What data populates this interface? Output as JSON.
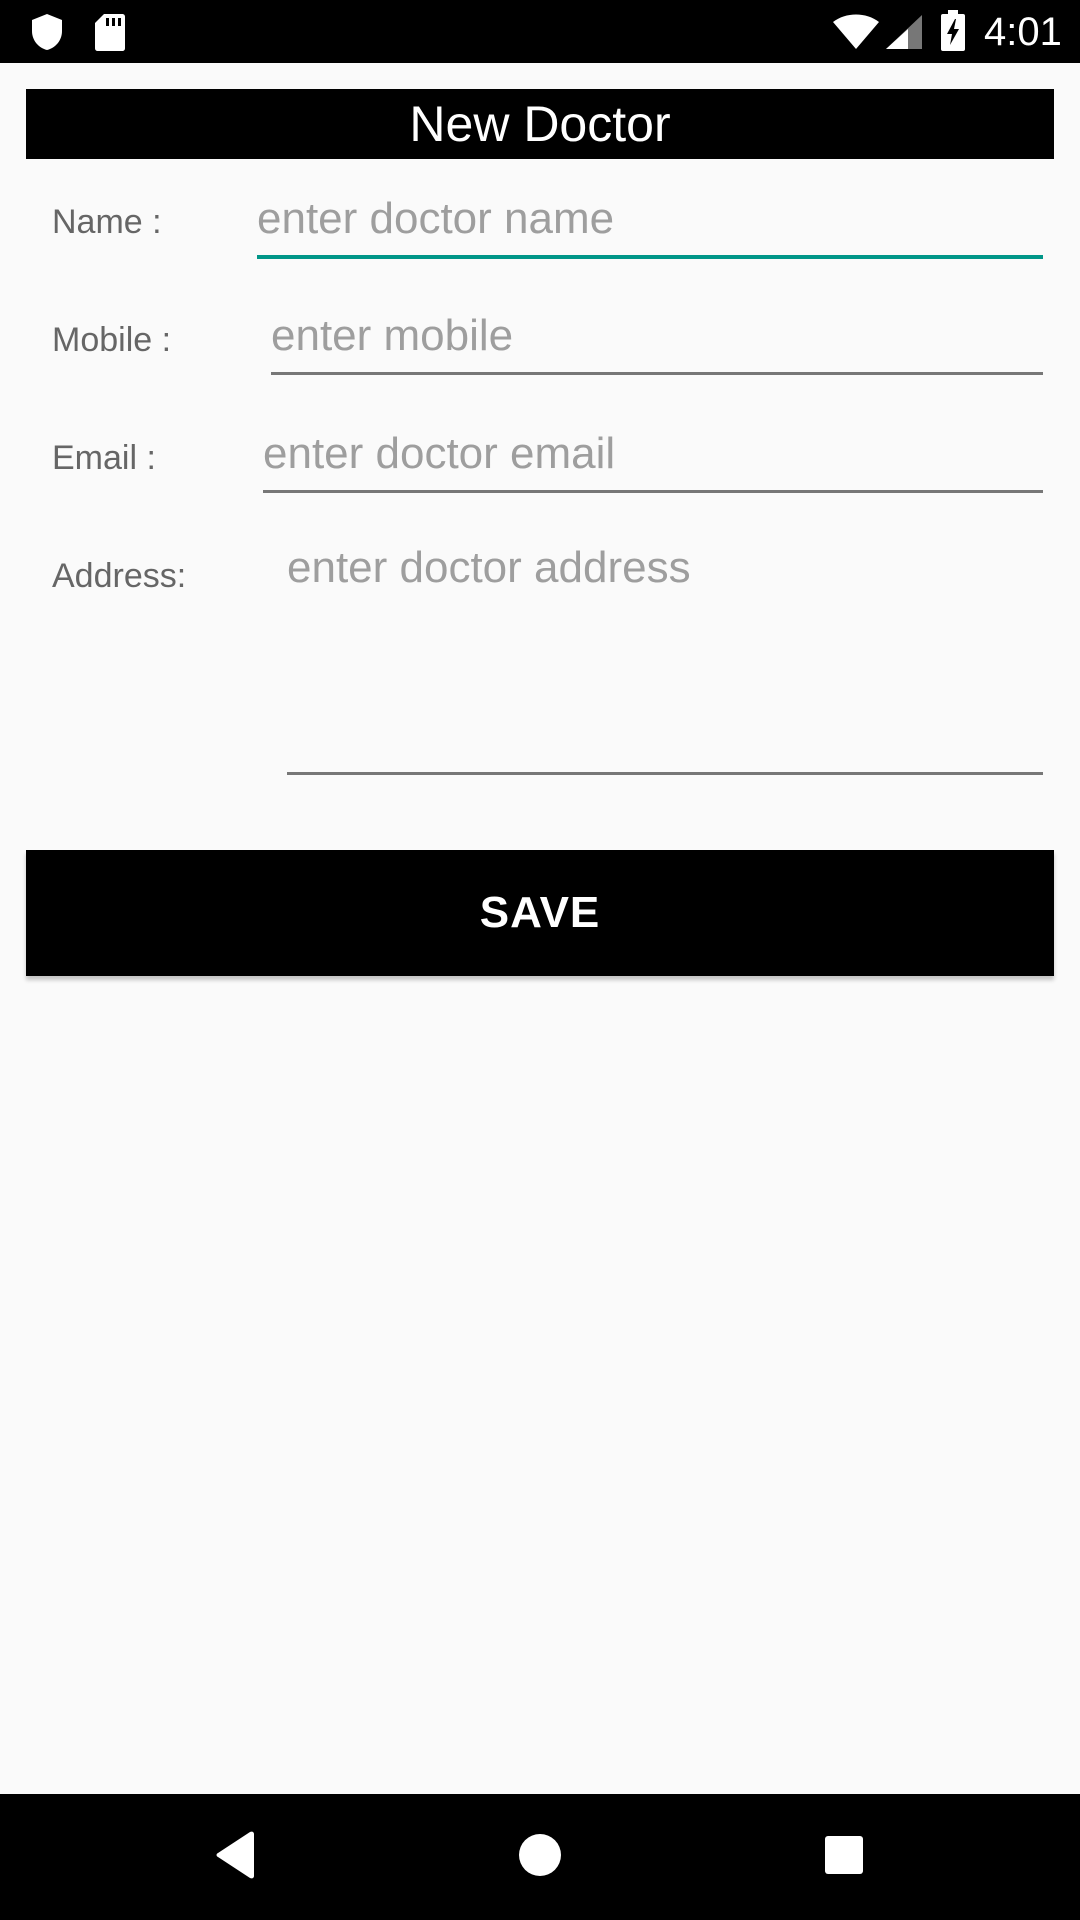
{
  "status_bar": {
    "time": "4:01",
    "icons": [
      "shield-icon",
      "sd-card-icon",
      "wifi-icon",
      "cell-signal-icon",
      "battery-charging-icon"
    ]
  },
  "header": {
    "title": "New Doctor"
  },
  "form": {
    "name": {
      "label": "Name :",
      "placeholder": "enter doctor name",
      "value": ""
    },
    "mobile": {
      "label": "Mobile :",
      "placeholder": "enter mobile",
      "value": ""
    },
    "email": {
      "label": "Email :",
      "placeholder": "enter doctor email",
      "value": ""
    },
    "address": {
      "label": "Address:",
      "placeholder": "enter doctor address",
      "value": ""
    },
    "save_label": "SAVE"
  },
  "navigation": {
    "icons": [
      "back-icon",
      "home-icon",
      "recents-icon"
    ]
  },
  "colors": {
    "accent": "#009688",
    "banner": "#000000",
    "background": "#fafafa",
    "label": "#666666",
    "placeholder": "#9e9e9e"
  }
}
